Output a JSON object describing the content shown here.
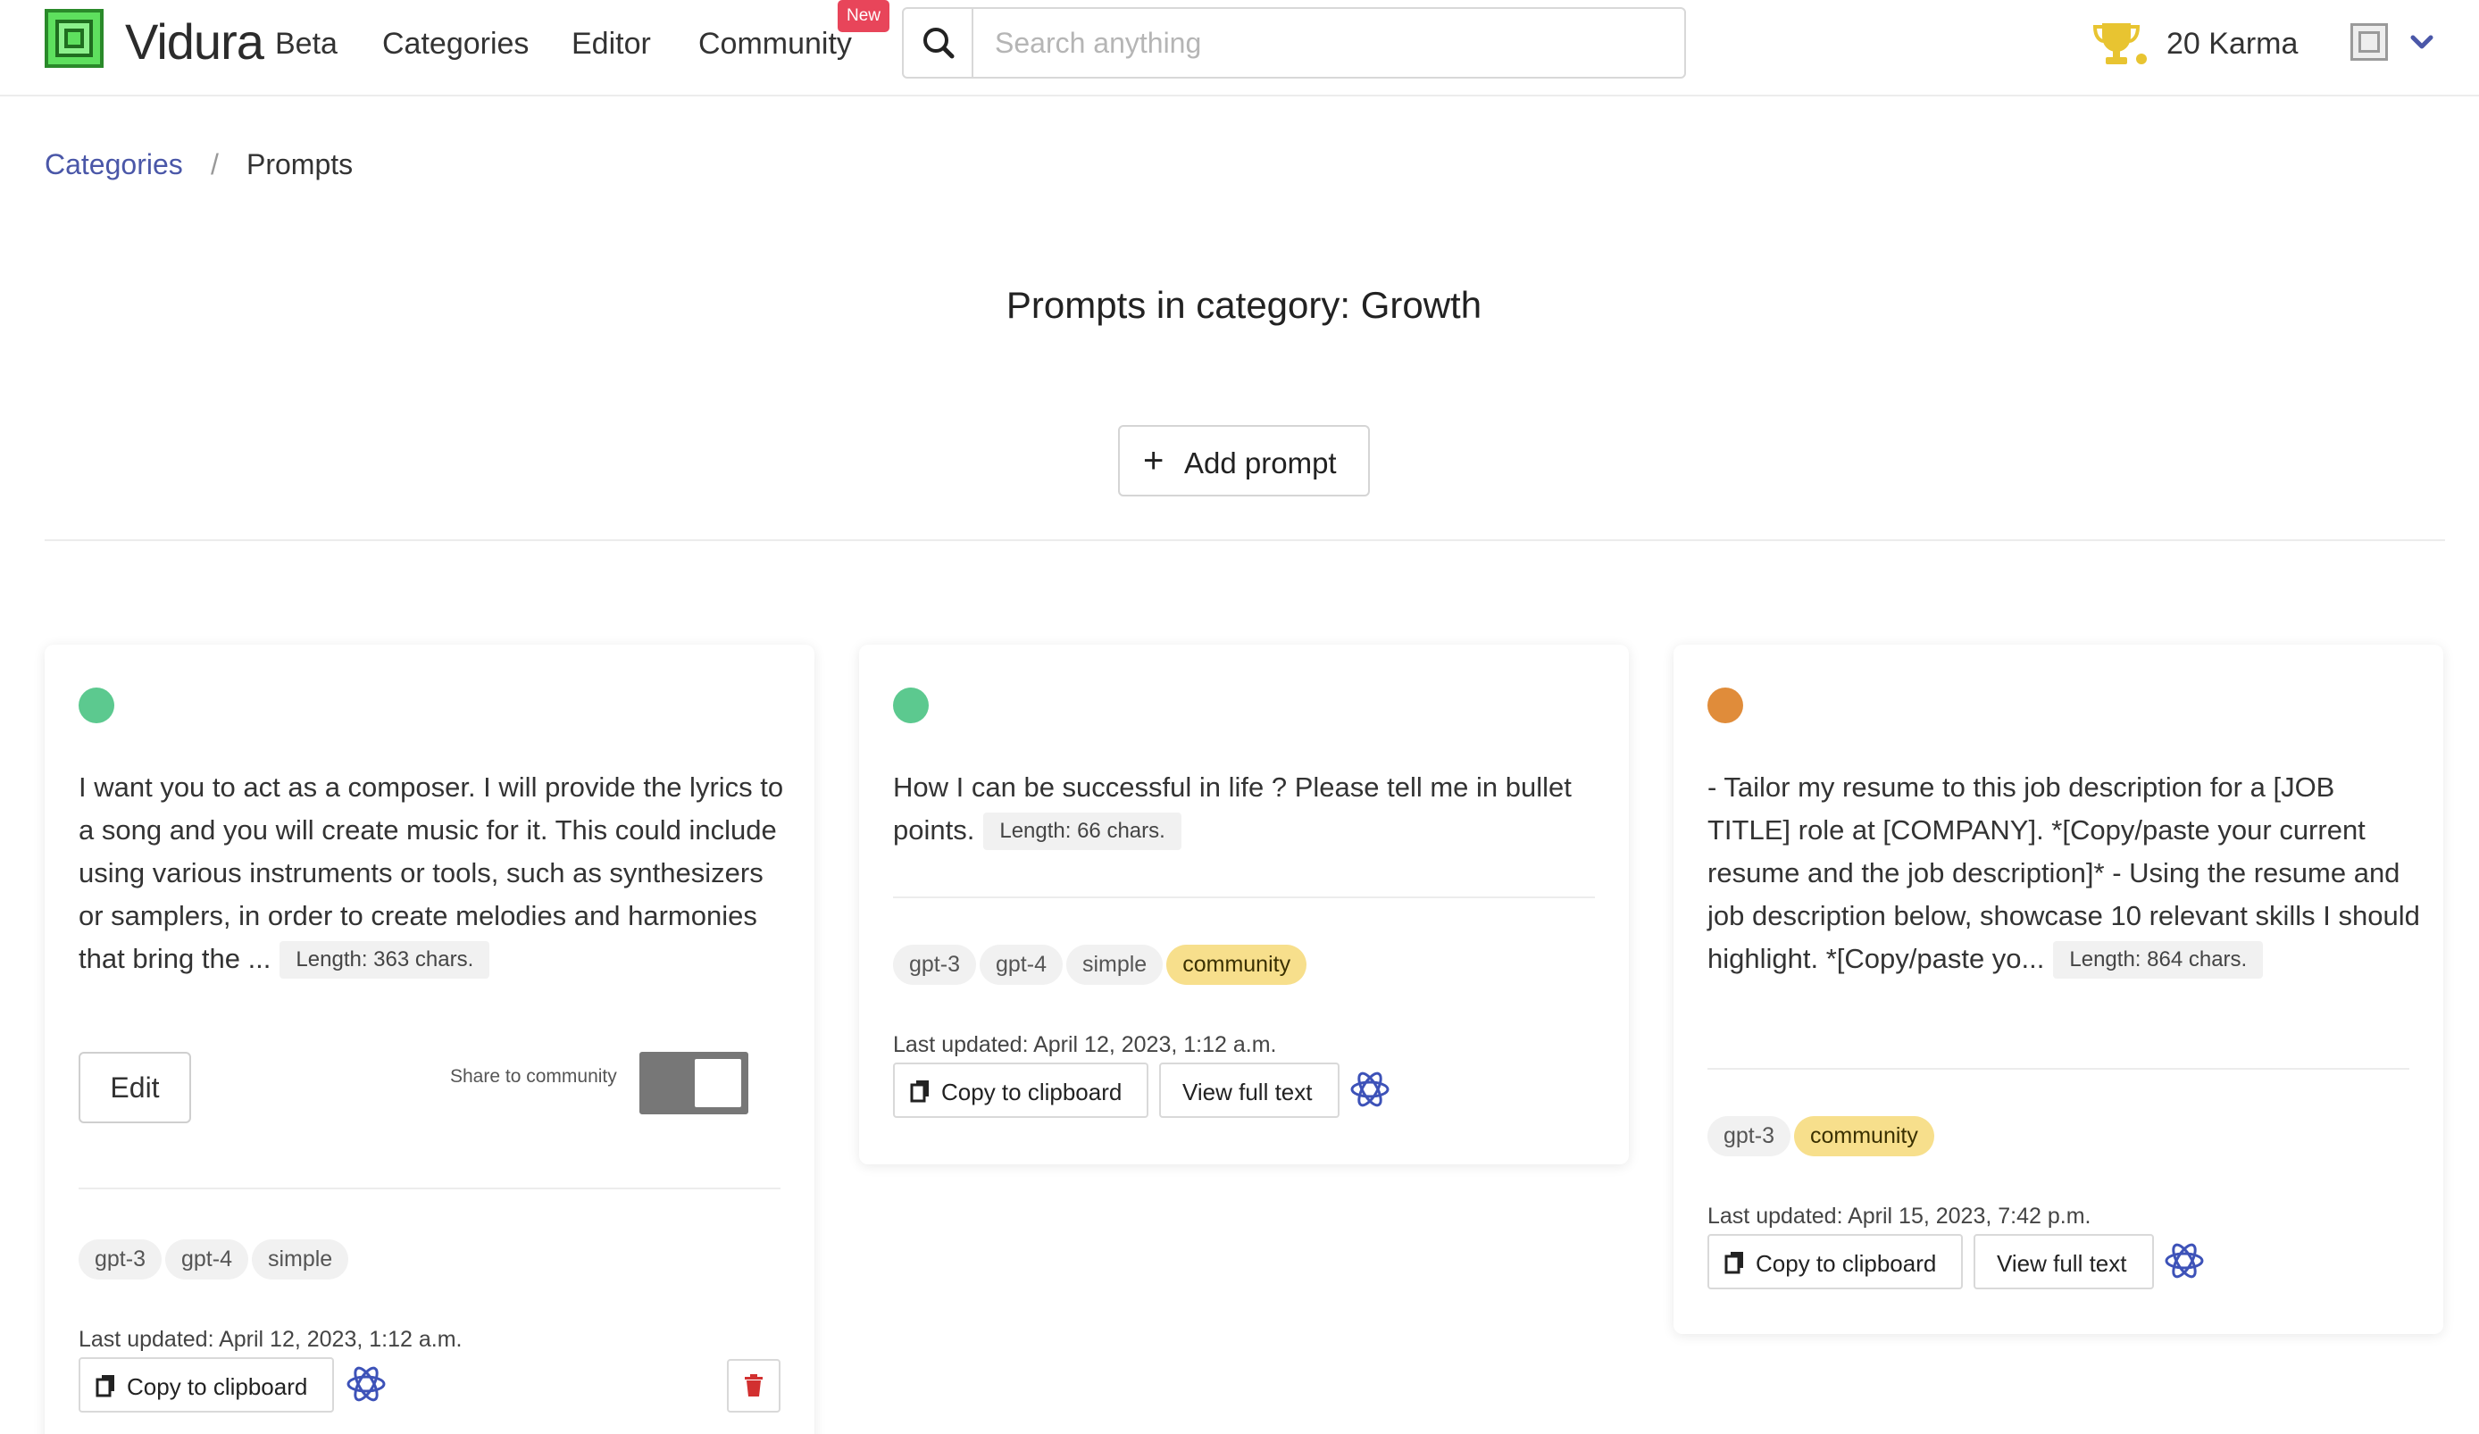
{
  "navbar": {
    "brand": "Vidura",
    "beta": "Beta",
    "links": [
      "Categories",
      "Editor",
      "Community"
    ],
    "community_badge": "New",
    "search_placeholder": "Search anything",
    "karma": "20 Karma",
    "colors": {
      "badge": "#e8455a",
      "trophy": "#e8c431",
      "chevron": "#4a57a8"
    }
  },
  "breadcrumb": {
    "parent": "Categories",
    "separator": "/",
    "current": "Prompts"
  },
  "page_title": "Prompts in category: Growth",
  "add_prompt_label": "Add prompt",
  "cards": [
    {
      "dot_color": "#5cc98f",
      "text": "I want you to act as a composer. I will provide the lyrics to a song and you will create music for it. This could include using various instruments or tools, such as synthesizers or samplers, in order to create melodies and harmonies that bring the ...",
      "length": "Length: 363 chars.",
      "edit_label": "Edit",
      "share_label": "Share to community",
      "tags": [
        "gpt-3",
        "gpt-4",
        "simple"
      ],
      "updated": "Last updated: April 12, 2023, 1:12 a.m.",
      "copy_label": "Copy to clipboard"
    },
    {
      "dot_color": "#5cc98f",
      "text": "How I can be successful in life ? Please tell me in bullet points.",
      "length": "Length: 66 chars.",
      "tags": [
        "gpt-3",
        "gpt-4",
        "simple",
        "community"
      ],
      "updated": "Last updated: April 12, 2023, 1:12 a.m.",
      "copy_label": "Copy to clipboard",
      "view_label": "View full text"
    },
    {
      "dot_color": "#e08c3a",
      "text": "- Tailor my resume to this job description for a [JOB TITLE] role at [COMPANY]. *[Copy/paste your current resume and the job description]* - Using the resume and job description below, showcase 10 relevant skills I should highlight. *[Copy/paste yo...",
      "length": "Length: 864 chars.",
      "tags": [
        "gpt-3",
        "community"
      ],
      "updated": "Last updated: April 15, 2023, 7:42 p.m.",
      "copy_label": "Copy to clipboard",
      "view_label": "View full text"
    }
  ]
}
